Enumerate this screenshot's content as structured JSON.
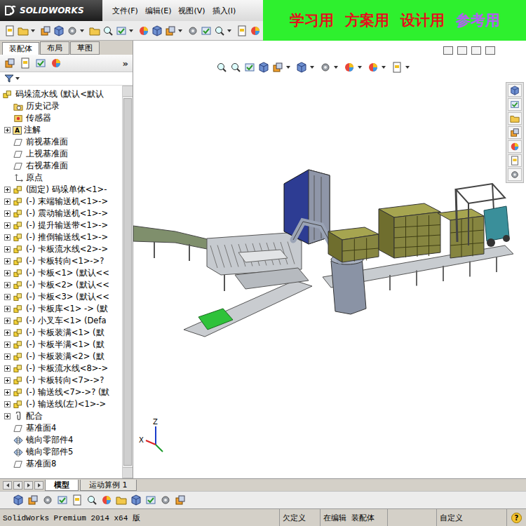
{
  "app": {
    "logo": "SOLIDWORKS"
  },
  "menu": [
    "文件(F)",
    "编辑(E)",
    "视图(V)",
    "插入(I)"
  ],
  "banner": [
    {
      "text": "学习用",
      "color": "#e3101c"
    },
    {
      "text": "方案用",
      "color": "#e3101c"
    },
    {
      "text": "设计用",
      "color": "#e3101c"
    },
    {
      "text": "参考用",
      "color": "#b45cf5"
    }
  ],
  "panel_tabs": [
    {
      "label": "装配体",
      "selected": true
    },
    {
      "label": "布局",
      "selected": false
    },
    {
      "label": "草图",
      "selected": false
    }
  ],
  "panel_more": "»",
  "tree": [
    {
      "label": "码垛流水线  (默认<默认",
      "kind": "assembly",
      "level": 0,
      "expandable": false,
      "expanded": true
    },
    {
      "label": "历史记录",
      "kind": "history",
      "level": 1,
      "expandable": false,
      "expanded": false
    },
    {
      "label": "传感器",
      "kind": "sensor",
      "level": 1,
      "expandable": false,
      "expanded": false
    },
    {
      "label": "注解",
      "kind": "annotation",
      "icon_text": "A",
      "level": 1,
      "expandable": true,
      "expanded": false
    },
    {
      "label": "前视基准面",
      "kind": "plane",
      "level": 1,
      "expandable": false,
      "expanded": false
    },
    {
      "label": "上视基准面",
      "kind": "plane",
      "level": 1,
      "expandable": false,
      "expanded": false
    },
    {
      "label": "右视基准面",
      "kind": "plane",
      "level": 1,
      "expandable": false,
      "expanded": false
    },
    {
      "label": "原点",
      "kind": "origin",
      "level": 1,
      "expandable": false,
      "expanded": false
    },
    {
      "label": "(固定) 码垛单体<1>-",
      "kind": "assembly",
      "level": 1,
      "expandable": true,
      "expanded": false
    },
    {
      "label": "(-) 末端输送机<1>->",
      "kind": "assembly",
      "level": 1,
      "expandable": true,
      "expanded": false
    },
    {
      "label": "(-) 震动输送机<1>->",
      "kind": "assembly",
      "level": 1,
      "expandable": true,
      "expanded": false
    },
    {
      "label": "(-) 提升输送带<1>->",
      "kind": "assembly",
      "level": 1,
      "expandable": true,
      "expanded": false
    },
    {
      "label": "(-) 推倒输送线<1>->",
      "kind": "assembly",
      "level": 1,
      "expandable": true,
      "expanded": false
    },
    {
      "label": "(-) 卡板流水线<2>->",
      "kind": "assembly",
      "level": 1,
      "expandable": true,
      "expanded": false
    },
    {
      "label": "(-) 卡板转向<1>->?",
      "kind": "assembly",
      "level": 1,
      "expandable": true,
      "expanded": false
    },
    {
      "label": "(-) 卡板<1> (默认<<",
      "kind": "assembly",
      "level": 1,
      "expandable": true,
      "expanded": false
    },
    {
      "label": "(-) 卡板<2> (默认<<",
      "kind": "assembly",
      "level": 1,
      "expandable": true,
      "expanded": false
    },
    {
      "label": "(-) 卡板<3> (默认<<",
      "kind": "assembly",
      "level": 1,
      "expandable": true,
      "expanded": false
    },
    {
      "label": "(-) 卡板库<1> -> (默",
      "kind": "assembly",
      "level": 1,
      "expandable": true,
      "expanded": false
    },
    {
      "label": "(-) 小叉车<1> (Defa",
      "kind": "assembly",
      "level": 1,
      "expandable": true,
      "expanded": false
    },
    {
      "label": "(-) 卡板装满<1> (默",
      "kind": "assembly",
      "level": 1,
      "expandable": true,
      "expanded": false
    },
    {
      "label": "(-) 卡板半满<1> (默",
      "kind": "assembly",
      "level": 1,
      "expandable": true,
      "expanded": false
    },
    {
      "label": "(-) 卡板装满<2> (默",
      "kind": "assembly",
      "level": 1,
      "expandable": true,
      "expanded": false
    },
    {
      "label": "(-) 卡板流水线<8>->",
      "kind": "assembly",
      "level": 1,
      "expandable": true,
      "expanded": false
    },
    {
      "label": "(-) 卡板转向<7>->?",
      "kind": "assembly",
      "level": 1,
      "expandable": true,
      "expanded": false
    },
    {
      "label": "(-) 输送线<7>->? (默",
      "kind": "assembly",
      "level": 1,
      "expandable": true,
      "expanded": false
    },
    {
      "label": "(-) 输送线(左)<1>->",
      "kind": "assembly",
      "level": 1,
      "expandable": true,
      "expanded": false
    },
    {
      "label": "配合",
      "kind": "mates",
      "level": 1,
      "expandable": true,
      "expanded": false
    },
    {
      "label": "基准面4",
      "kind": "plane",
      "level": 1,
      "expandable": false,
      "expanded": false
    },
    {
      "label": "镜向零部件4",
      "kind": "mirror",
      "level": 1,
      "expandable": false,
      "expanded": false
    },
    {
      "label": "镜向零部件5",
      "kind": "mirror",
      "level": 1,
      "expandable": false,
      "expanded": false
    },
    {
      "label": "基准面8",
      "kind": "plane",
      "level": 1,
      "expandable": false,
      "expanded": false
    }
  ],
  "triad": {
    "z": "Z",
    "x": "X"
  },
  "bottom_tabs": [
    {
      "label": "模型",
      "selected": true
    },
    {
      "label": "运动算例 1",
      "selected": false
    }
  ],
  "status_bar": {
    "product": "SolidWorks Premium 2014 x64 版",
    "state": "欠定义",
    "mode": "在编辑 装配体",
    "units": "自定义",
    "help": "?"
  }
}
